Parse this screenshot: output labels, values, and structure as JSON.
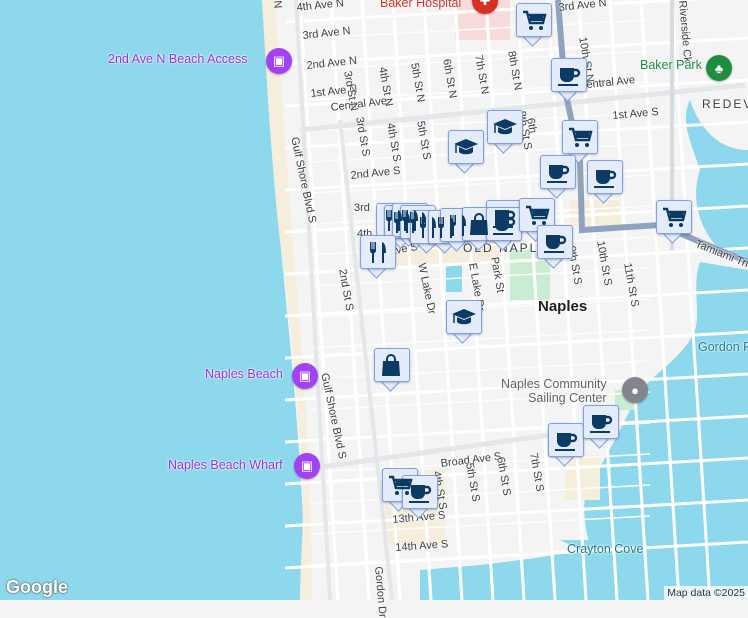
{
  "map": {
    "colors": {
      "water": "#8ed8ee",
      "land": "#f4f4f4",
      "beach": "#f6eedc",
      "park": "#c9ecd3",
      "hospital": "#f8dcdc",
      "marker_fill": "#e4ecfb",
      "marker_icon": "#0b3a63",
      "highway": "#8fa3bf"
    },
    "streets": [
      "4th Ave N",
      "3rd Ave N",
      "2nd Ave N",
      "1st Ave N",
      "Central Ave",
      "Central Ave",
      "1st Ave S",
      "2nd Ave S",
      "3rd",
      "4th",
      "Ave S",
      "3rd Ave N",
      "3rd St N",
      "4th St N",
      "5th St N",
      "6th St N",
      "7th St N",
      "8th St N",
      "10th St N",
      "3rd St S",
      "4th St S",
      "5th St S",
      "6th",
      "8th St S",
      "9th St S",
      "10th St S",
      "11th St S",
      "Gulf Shore Blvd S",
      "Gulf Shore Blvd S",
      "2nd St S",
      "W Lake Dr",
      "E Lake Dr",
      "Park St",
      "Tamiami Trl",
      "Riverside Ck",
      "Broad Ave S",
      "4th St S",
      "5th St S",
      "6th St S",
      "7th St S",
      "13th Ave S",
      "14th Ave S",
      "Gordon Dr",
      "N"
    ],
    "places": {
      "hospital": "Baker Hospital",
      "beach_access": "2nd Ave N Beach Access",
      "park": "Baker Park",
      "district": "REDEV",
      "old_naples": "OLD NAPL",
      "city": "Naples",
      "gordon": "Gordon P",
      "naples_beach": "Naples Beach",
      "sailing_center": "Naples Community\nSailing Center",
      "wharf": "Naples Beach Wharf",
      "crayton": "Crayton Cove"
    },
    "markers": [
      "cart",
      "cup",
      "graduation-cap",
      "graduation-cap",
      "cart",
      "cup",
      "cup",
      "cart",
      "fork-knife",
      "fork-knife",
      "fork-knife",
      "fork-knife",
      "fork-knife",
      "fork-knife",
      "fork-knife",
      "cup",
      "bag",
      "cup",
      "cart",
      "cup",
      "fork-knife",
      "graduation-cap",
      "bag",
      "cup",
      "cup",
      "cart",
      "cup"
    ],
    "logo": "Google",
    "attribution": "Map data ©2025"
  }
}
